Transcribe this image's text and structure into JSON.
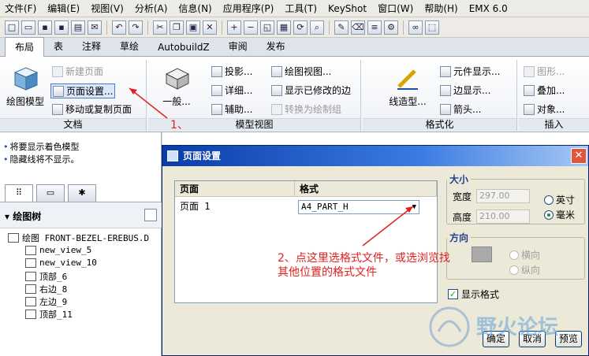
{
  "menubar": {
    "items": [
      "文件(F)",
      "编辑(E)",
      "视图(V)",
      "分析(A)",
      "信息(N)",
      "应用程序(P)",
      "工具(T)",
      "KeyShot",
      "窗口(W)",
      "帮助(H)",
      "EMX 6.0"
    ]
  },
  "ribbon": {
    "tabs": [
      "布局",
      "表",
      "注释",
      "草绘",
      "AutobuildZ",
      "审阅",
      "发布"
    ],
    "groups": {
      "doc": {
        "title": "文档",
        "drawing_model": "绘图模型",
        "new_page": "新建页面",
        "page_setup": "页面设置...",
        "move_copy_page": "移动或复制页面"
      },
      "model_view": {
        "title": "模型视图",
        "general": "一般...",
        "projection": "投影...",
        "detail": "详细...",
        "auxiliary": "辅助...",
        "drawing_view": "绘图视图...",
        "show_modified_edges": "显示已修改的边",
        "convert_to_draft": "转换为绘制组"
      },
      "format": {
        "title": "格式化",
        "line_style": "线造型...",
        "element_display": "元件显示...",
        "edge_display": "边显示...",
        "arrow": "箭头..."
      },
      "insert": {
        "title": "插入",
        "graphics": "图形...",
        "overlay": "叠加...",
        "object": "对象..."
      }
    }
  },
  "left_panel": {
    "messages": [
      "将要显示着色模型",
      "隐藏线将不显示。"
    ],
    "tree_title": "绘图树",
    "tree_root": "绘图 FRONT-BEZEL-EREBUS.D",
    "tree_items": [
      "new_view_5",
      "new_view_10",
      "顶部_6",
      "右边_8",
      "左边_9",
      "顶部_11"
    ]
  },
  "dialog": {
    "title": "页面设置",
    "table": {
      "headers": [
        "页面",
        "格式"
      ],
      "rows": [
        {
          "page": "页面 1",
          "format": "A4_PART_H"
        }
      ]
    },
    "size": {
      "legend": "大小",
      "width_label": "宽度",
      "width_value": "297.00",
      "height_label": "高度",
      "height_value": "210.00",
      "unit_inch": "英寸",
      "unit_mm": "毫米",
      "selected_unit": "mm"
    },
    "orientation": {
      "legend": "方向",
      "landscape": "横向",
      "portrait": "纵向"
    },
    "show_format_label": "显示格式",
    "show_format_checked": true,
    "buttons": {
      "ok": "确定",
      "cancel": "取消",
      "preview": "预览"
    }
  },
  "annotations": {
    "step1": "1、",
    "step2_line1": "2、点这里选格式文件，或选浏览找",
    "step2_line2": "其他位置的格式文件",
    "color": "#e02020"
  },
  "watermark": {
    "text": "野火论坛"
  }
}
